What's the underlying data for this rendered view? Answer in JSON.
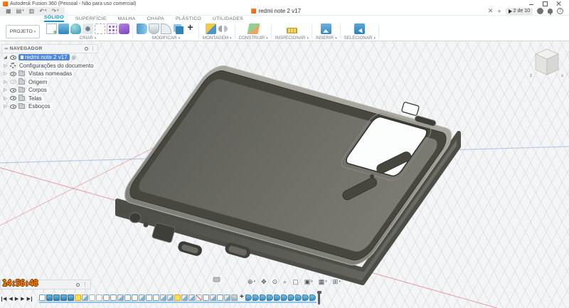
{
  "window": {
    "title": "Autodesk Fusion 360 (Pessoal - Não para uso comercial)"
  },
  "tab_bar": {
    "document_tab": "redmi note 2 v17",
    "counter_badge": "2 de 10"
  },
  "ribbon": {
    "project_button": "PROJETO",
    "tabs": [
      {
        "label": "SÓLIDO",
        "active": true
      },
      {
        "label": "SUPERFÍCIE"
      },
      {
        "label": "MALHA"
      },
      {
        "label": "CHAPA"
      },
      {
        "label": "PLÁSTICO"
      },
      {
        "label": "UTILIDADES"
      }
    ],
    "groups": [
      {
        "label": "CRIAR",
        "tools": [
          {
            "icon": "create-sketch"
          },
          {
            "icon": "extrude"
          },
          {
            "icon": "revolve"
          },
          {
            "icon": "hole"
          },
          {
            "icon": "spline"
          },
          {
            "icon": "pattern"
          },
          {
            "icon": "create-form"
          }
        ]
      },
      {
        "label": "MODIFICAR",
        "tools": [
          {
            "icon": "press-pull"
          },
          {
            "icon": "shell"
          },
          {
            "icon": "fillet"
          },
          {
            "icon": "combine"
          },
          {
            "icon": "move"
          }
        ]
      },
      {
        "label": "MONTAGEM",
        "tools": [
          {
            "icon": "new-component"
          },
          {
            "icon": "joint"
          }
        ]
      },
      {
        "label": "CONSTRUIR",
        "tools": [
          {
            "icon": "construction-plane"
          }
        ]
      },
      {
        "label": "INSPECIONAR",
        "tools": [
          {
            "icon": "measure"
          }
        ]
      },
      {
        "label": "INSERIR",
        "tools": [
          {
            "icon": "insert-image"
          }
        ]
      },
      {
        "label": "SELECIONAR",
        "tools": [
          {
            "icon": "select"
          }
        ]
      }
    ]
  },
  "browser": {
    "header": "NAVEGADOR",
    "root": "redmi note 2 v17",
    "items": [
      {
        "label": "Configurações do documento",
        "icon": "gear"
      },
      {
        "label": "Vistas nomeadas",
        "icon": "folder"
      },
      {
        "label": "Origem",
        "icon": "folder",
        "hidden": true
      },
      {
        "label": "Corpos",
        "icon": "folder"
      },
      {
        "label": "Telas",
        "icon": "folder"
      },
      {
        "label": "Esboços",
        "icon": "folder"
      }
    ]
  },
  "viewcube": {
    "axis_z": "z",
    "axis_x": "x"
  },
  "overlay": {
    "recording_time": "14:56:48"
  },
  "navbar": {
    "buttons": [
      "orbit",
      "pan",
      "look-at",
      "zoom",
      "fit-view",
      "display-settings",
      "grid-settings",
      "viewports"
    ]
  },
  "timeline": {
    "icons": [
      "sketch",
      "extrude",
      "extrude",
      "extrude",
      "extrude",
      "sketch-active",
      "fillet",
      "doc",
      "doc",
      "sketch",
      "sketch",
      "fillet",
      "sketch",
      "sketch",
      "fillet",
      "sketch",
      "sketch",
      "fillet",
      "fillet",
      "sketch-active",
      "fillet",
      "fillet",
      "split",
      "sketch",
      "fillet",
      "sketch",
      "fillet",
      "chamfer",
      "move",
      "fillet-blue",
      "fillet-blue",
      "fillet-blue",
      "fillet-blue",
      "fillet-blue",
      "fillet-blue",
      "fillet-blue",
      "fillet-blue",
      "fillet-blue",
      "fillet-blue"
    ]
  },
  "colors": {
    "accent_blue": "#0696d7",
    "axis_red": "#e08a95",
    "axis_blue": "#a9bcd9",
    "phone_rim_near": "#80807a",
    "phone_rim_far": "#a8a8a1",
    "phone_wall": "#47473f",
    "phone_floor_left": "#60605a",
    "phone_floor_right": "#7b7b73",
    "phone_outer_left": "#4c4c46",
    "phone_outer_right": "#6e6e67"
  }
}
